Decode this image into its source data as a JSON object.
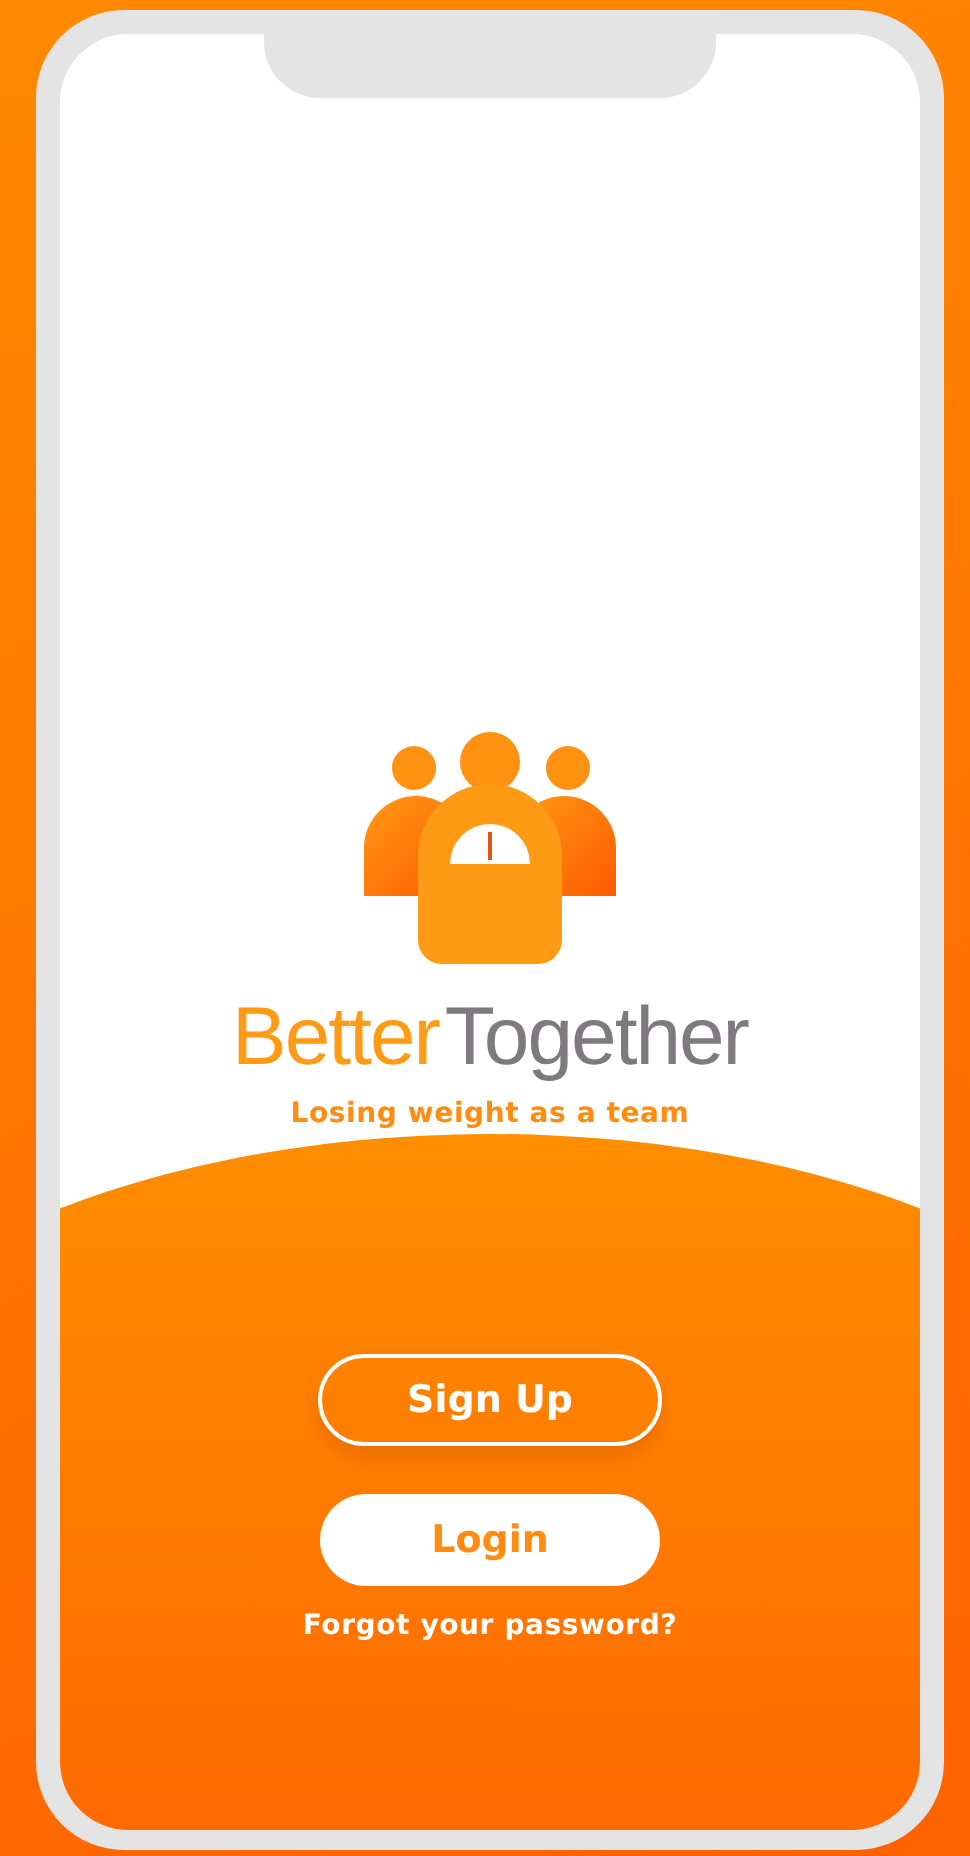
{
  "brand": {
    "name_parts": [
      {
        "text": "Better",
        "kind": "accent"
      },
      {
        "text": "Together",
        "kind": "muted"
      }
    ],
    "tagline": "Losing weight as a team"
  },
  "buttons": [
    {
      "label": "Sign Up",
      "kind": "outline"
    },
    {
      "label": "Login",
      "kind": "filled"
    }
  ],
  "forgot_link": "Forgot your password?"
}
